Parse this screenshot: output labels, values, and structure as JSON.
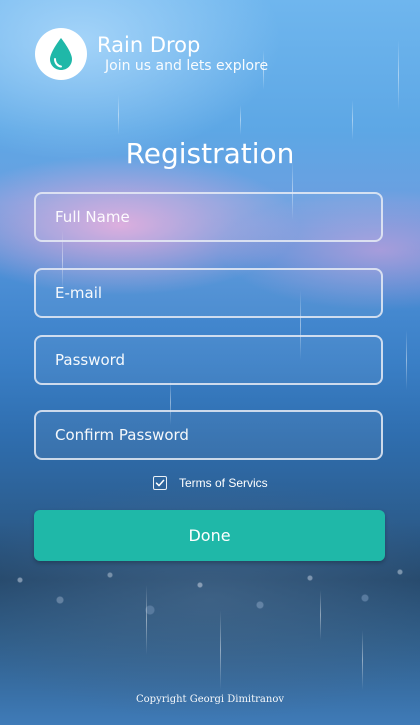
{
  "header": {
    "app_title": "Rain Drop",
    "app_subtitle": "Join us and lets explore",
    "logo_icon": "water-drop-icon",
    "logo_color": "#1fb8a8"
  },
  "form": {
    "title": "Registration",
    "fields": [
      {
        "name": "full-name",
        "placeholder": "Full Name",
        "value": ""
      },
      {
        "name": "email",
        "placeholder": "E-mail",
        "value": ""
      },
      {
        "name": "password",
        "placeholder": "Password",
        "value": ""
      },
      {
        "name": "confirm-password",
        "placeholder": "Confirm Password",
        "value": ""
      }
    ],
    "terms_label": "Terms of Servics",
    "terms_checked": true,
    "submit_label": "Done"
  },
  "footer": {
    "copyright": "Copyright Georgi Dimitranov"
  },
  "colors": {
    "accent": "#1fb8a8",
    "field_border": "#e6ebf5"
  }
}
